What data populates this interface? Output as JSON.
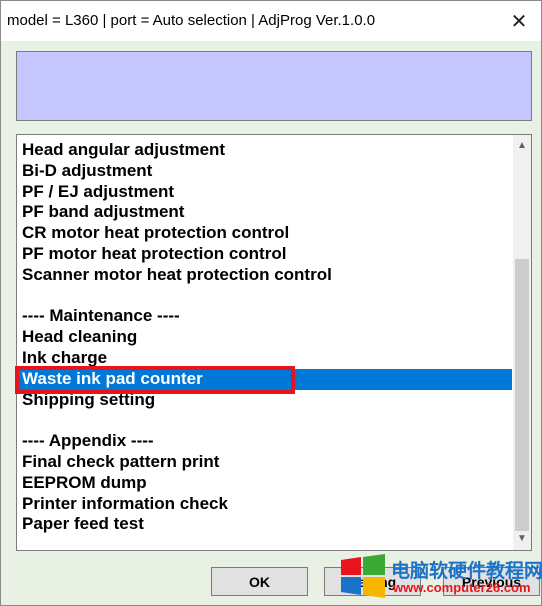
{
  "window": {
    "title": "model = L360 | port = Auto selection | AdjProg Ver.1.0.0",
    "close_label": "✕"
  },
  "status_box": {
    "text": ""
  },
  "list": {
    "items": [
      "Head angular adjustment",
      "Bi-D adjustment",
      "PF / EJ adjustment",
      "PF band adjustment",
      "CR motor heat protection control",
      "PF motor heat protection control",
      "Scanner motor heat protection control",
      "",
      "---- Maintenance ----",
      "Head cleaning",
      "Ink charge",
      "Waste ink pad counter",
      "Shipping setting",
      "",
      "---- Appendix ----",
      "Final check pattern print",
      "EEPROM dump",
      "Printer information check",
      "Paper feed test"
    ],
    "selected_index": 11
  },
  "scrollbar": {
    "up_arrow": "▲",
    "down_arrow": "▼"
  },
  "buttons": {
    "ok": "OK",
    "next": "Setting",
    "previous": "Previous"
  },
  "watermark": {
    "text": "电脑软硬件教程网",
    "url": "www.computer26.com"
  },
  "colors": {
    "selection": "#0078d7",
    "status_box": "#c6c6ff",
    "highlight": "#e8141c"
  }
}
